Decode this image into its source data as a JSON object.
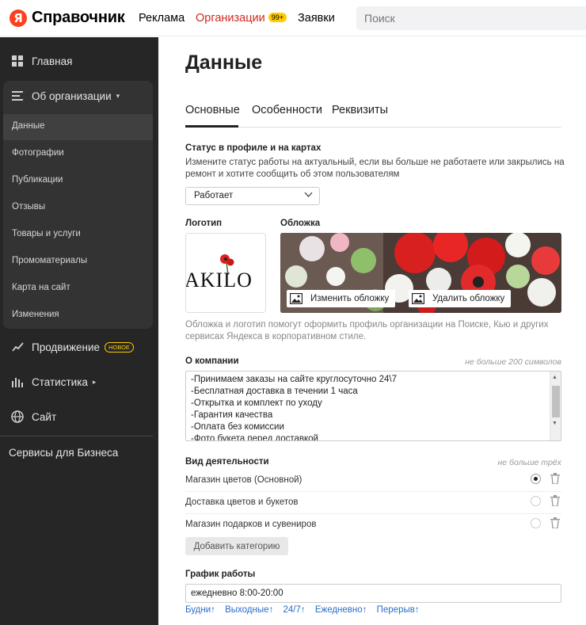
{
  "header": {
    "logo_letter": "Я",
    "logo_text": "Справочник",
    "nav": [
      {
        "label": "Реклама"
      },
      {
        "label": "Организации",
        "badge": "99+"
      },
      {
        "label": "Заявки"
      }
    ],
    "search_placeholder": "Поиск"
  },
  "sidebar": {
    "items": [
      {
        "label": "Главная",
        "icon": "grid-icon"
      },
      {
        "label": "Об организации",
        "icon": "lines-icon",
        "caret": "▾"
      },
      {
        "label": "Продвижение",
        "icon": "trend-icon",
        "badge": "НОВОЕ"
      },
      {
        "label": "Статистика",
        "icon": "bars-icon",
        "caret": "▸"
      },
      {
        "label": "Сайт",
        "icon": "globe-icon"
      }
    ],
    "sub_items": [
      "Данные",
      "Фотографии",
      "Публикации",
      "Отзывы",
      "Товары и услуги",
      "Промоматериалы",
      "Карта на сайт",
      "Изменения"
    ],
    "footer_link": "Сервисы для Бизнеса"
  },
  "main": {
    "title": "Данные",
    "tabs": [
      "Основные",
      "Особенности",
      "Реквизиты"
    ],
    "status": {
      "title": "Статус в профиле и на картах",
      "hint_line1": "Измените статус работы на актуальный, если вы больше не работаете или закрылись на",
      "hint_line2": "ремонт и хотите сообщить об этом пользователям",
      "value": "Работает"
    },
    "logo": {
      "title": "Логотип",
      "brand_text": "AKILO"
    },
    "cover": {
      "title": "Обложка",
      "change_label": "Изменить обложку",
      "delete_label": "Удалить обложку"
    },
    "media_hint_line1": "Обложка и логотип помогут оформить профиль организации на Поиске, Кью и других",
    "media_hint_line2": "сервисах Яндекса в корпоративном стиле.",
    "about": {
      "title": "О компании",
      "limit": "не больше 200 символов",
      "lines": [
        "-Принимаем заказы на сайте круглосуточно 24\\7",
        "-Бесплатная доставка в течении 1 часа",
        "-Открытка и комплект по уходу",
        "-Гарантия качества",
        "-Оплата без комиссии",
        "-Фото букета перед доставкой"
      ]
    },
    "activity": {
      "title": "Вид деятельности",
      "limit": "не больше трёх",
      "categories": [
        {
          "label": "Магазин цветов  (Основной)",
          "primary": true
        },
        {
          "label": "Доставка цветов и букетов",
          "primary": false
        },
        {
          "label": "Магазин подарков и сувениров",
          "primary": false
        }
      ],
      "add_label": "Добавить категорию"
    },
    "schedule": {
      "title": "График работы",
      "value": "ежедневно 8:00-20:00",
      "presets": [
        "Будни↑",
        "Выходные↑",
        "24/7↑",
        "Ежедневно↑",
        "Перерыв↑"
      ]
    }
  },
  "colors": {
    "accent_red": "#d1281f",
    "badge_yellow": "#ffcc00",
    "sidebar_bg": "#262626",
    "link_blue": "#2a6ec8"
  }
}
